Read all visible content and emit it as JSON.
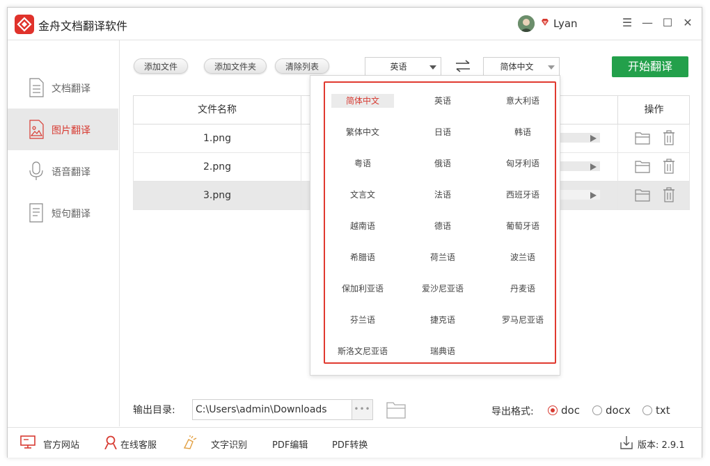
{
  "app": {
    "title": "金舟文档翻译软件",
    "user_name": "Lyan"
  },
  "window_controls": {
    "menu": "☰",
    "minimize": "—",
    "maximize": "☐",
    "close": "✕"
  },
  "sidebar": {
    "items": [
      {
        "label": "文档翻译",
        "icon": "document-icon",
        "active": false
      },
      {
        "label": "图片翻译",
        "icon": "image-icon",
        "active": true
      },
      {
        "label": "语音翻译",
        "icon": "microphone-icon",
        "active": false
      },
      {
        "label": "短句翻译",
        "icon": "text-icon",
        "active": false
      }
    ]
  },
  "toolbar": {
    "add_file": "添加文件",
    "add_folder": "添加文件夹",
    "clear_list": "清除列表",
    "source_lang": "英语",
    "target_lang": "简体中文",
    "start": "开始翻译"
  },
  "table": {
    "headers": {
      "name": "文件名称",
      "ops": "操作"
    },
    "rows": [
      {
        "name": "1.png",
        "selected": false
      },
      {
        "name": "2.png",
        "selected": false
      },
      {
        "name": "3.png",
        "selected": true
      }
    ]
  },
  "dropdown": {
    "selected": "简体中文",
    "options": [
      "简体中文",
      "英语",
      "意大利语",
      "繁体中文",
      "日语",
      "韩语",
      "粤语",
      "俄语",
      "匈牙利语",
      "文言文",
      "法语",
      "西班牙语",
      "越南语",
      "德语",
      "葡萄牙语",
      "希腊语",
      "荷兰语",
      "波兰语",
      "保加利亚语",
      "爱沙尼亚语",
      "丹麦语",
      "芬兰语",
      "捷克语",
      "罗马尼亚语",
      "斯洛文尼亚语",
      "瑞典语"
    ]
  },
  "output": {
    "label": "输出目录:",
    "path": "C:\\Users\\admin\\Downloads",
    "more": "•••",
    "format_label": "导出格式:",
    "formats": [
      {
        "label": "doc",
        "selected": true
      },
      {
        "label": "docx",
        "selected": false
      },
      {
        "label": "txt",
        "selected": false
      }
    ]
  },
  "footer": {
    "website": "官方网站",
    "service": "在线客服",
    "ocr": "文字识别",
    "pdf_edit": "PDF编辑",
    "pdf_convert": "PDF转换",
    "version": "版本: 2.9.1"
  },
  "colors": {
    "accent": "#d73a31",
    "start_button": "#23a04b",
    "dropdown_border": "#e0392f"
  }
}
